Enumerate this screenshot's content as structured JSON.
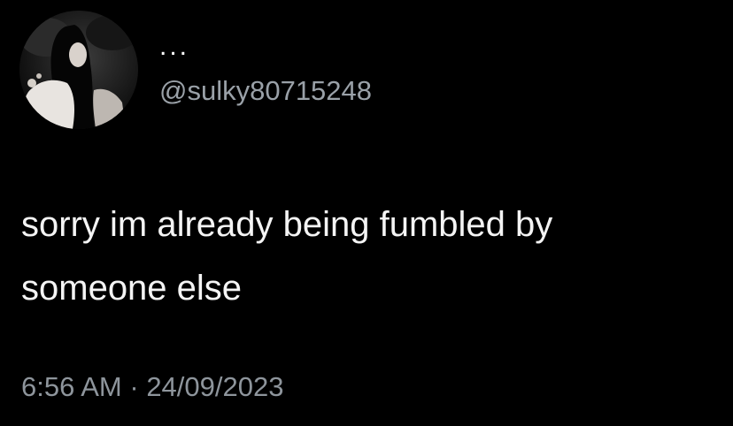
{
  "tweet": {
    "display_name": "...",
    "handle": "@sulky80715248",
    "text": "sorry im already being fumbled by\nsomeone else",
    "time": "6:56 AM",
    "separator": " · ",
    "date": "24/09/2023"
  },
  "avatar": {
    "icon": "profile-photo"
  },
  "colors": {
    "background": "#000000",
    "text": "#f4f4f4",
    "secondary_text": "#8e959c"
  }
}
